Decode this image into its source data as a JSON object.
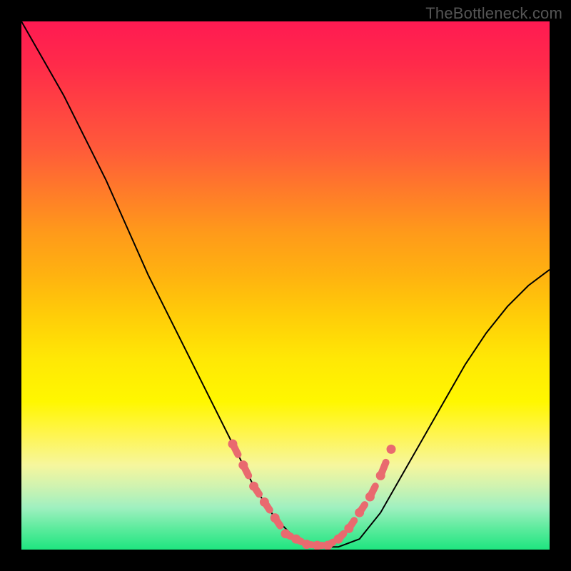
{
  "watermark": "TheBottleneck.com",
  "chart_data": {
    "type": "line",
    "title": "",
    "xlabel": "",
    "ylabel": "",
    "xlim": [
      0,
      100
    ],
    "ylim": [
      0,
      100
    ],
    "background_gradient": {
      "top": "#ff1a52",
      "mid": "#fff700",
      "bottom": "#1fe580"
    },
    "series": [
      {
        "name": "curve",
        "x": [
          0,
          4,
          8,
          12,
          16,
          20,
          24,
          28,
          32,
          36,
          40,
          44,
          48,
          52,
          56,
          60,
          64,
          68,
          72,
          76,
          80,
          84,
          88,
          92,
          96,
          100
        ],
        "y": [
          100,
          93,
          86,
          78,
          70,
          61,
          52,
          44,
          36,
          28,
          20,
          12,
          6,
          2,
          0.5,
          0.5,
          2,
          7,
          14,
          21,
          28,
          35,
          41,
          46,
          50,
          53
        ]
      }
    ],
    "markers": {
      "name": "highlighted-range",
      "color": "#e96a6f",
      "x": [
        40,
        42,
        44,
        46,
        48,
        50,
        52,
        54,
        56,
        58,
        60,
        62,
        64,
        66,
        68,
        70
      ],
      "y": [
        20,
        16,
        12,
        9,
        6,
        3,
        2,
        1,
        0.8,
        0.8,
        2,
        4,
        7,
        10,
        14,
        19
      ]
    }
  }
}
